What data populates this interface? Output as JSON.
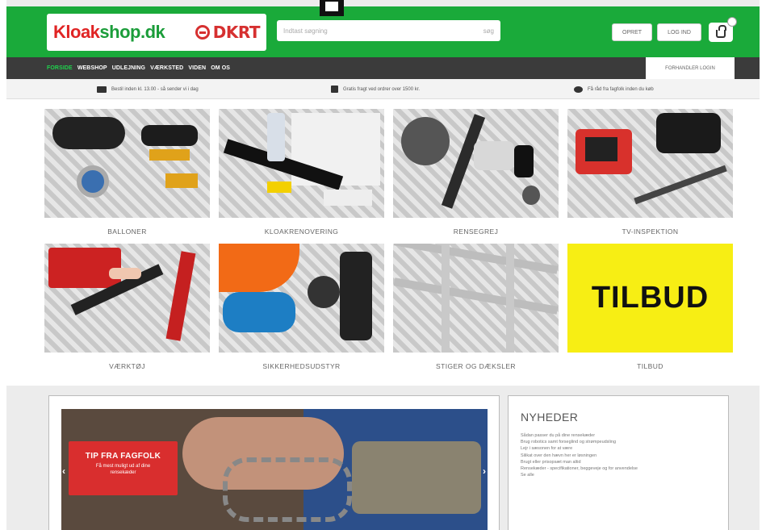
{
  "header": {
    "logo_brand_red": "Kloak",
    "logo_brand_green": "shop.dk",
    "partner_logo": "DKRT",
    "search_placeholder": "Indtast søgning",
    "search_hint": "søg",
    "opret_label": "OPRET",
    "login_label": "LOG IND"
  },
  "nav": {
    "items": [
      {
        "label": "FORSIDE",
        "active": true
      },
      {
        "label": "WEBSHOP",
        "active": false
      },
      {
        "label": "UDLEJNING",
        "active": false
      },
      {
        "label": "VÆRKSTED",
        "active": false
      },
      {
        "label": "VIDEN",
        "active": false
      },
      {
        "label": "OM OS",
        "active": false
      }
    ],
    "dealer_label": "FORHANDLER LOGIN"
  },
  "usp": [
    {
      "icon": "truck-icon",
      "text": "Bestil inden kl. 13.00 - så sender vi i dag"
    },
    {
      "icon": "gift-icon",
      "text": "Gratis fragt ved ordrer over 1500 kr."
    },
    {
      "icon": "chat-icon",
      "text": "Få råd fra fagfolk inden du køb"
    }
  ],
  "categories": [
    {
      "label": "BALLONER"
    },
    {
      "label": "KLOAKRENOVERING"
    },
    {
      "label": "RENSEGREJ"
    },
    {
      "label": "TV-INSPEKTION"
    },
    {
      "label": "VÆRKTØJ"
    },
    {
      "label": "SIKKERHEDSUDSTYR"
    },
    {
      "label": "STIGER OG DÆKSLER"
    },
    {
      "label": "TILBUD",
      "image_text": "TILBUD",
      "color": "#f7ee14"
    }
  ],
  "slider": {
    "tip_title": "TIP FRA FAGFOLK",
    "tip_sub": "Få mest muligt ud af dine rensekæder",
    "prev": "‹",
    "next": "›"
  },
  "news": {
    "title": "NYHEDER",
    "items": [
      "Sådan passer du på dine rensekæder",
      "Brug robotics samt forseglind og strømpeudsling",
      "Lejr i sæsonen for at være",
      "Silikat over den hævn her er løsningen",
      "Brugt eller prisopsæt man altid",
      "Rensekæder - specifikationer, beggeveje og for anvendelse",
      "Se alle"
    ]
  },
  "colors": {
    "brand_green": "#1aaa3a",
    "nav_dark": "#3b3b3b",
    "tilbud_yellow": "#f7ee14",
    "tip_red": "#d92e2e"
  }
}
